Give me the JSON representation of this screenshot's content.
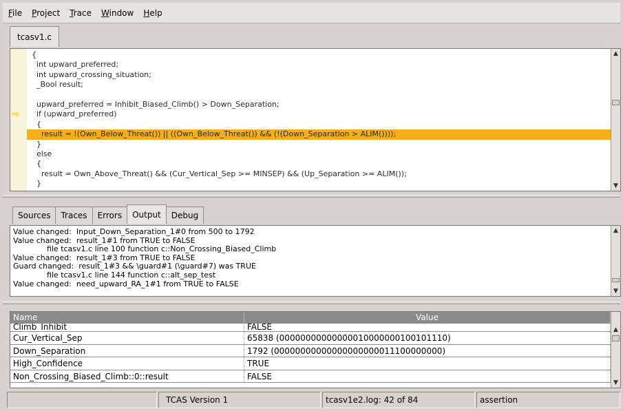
{
  "menu": [
    {
      "label": "File",
      "name": "menu-file"
    },
    {
      "label": "Project",
      "name": "menu-project"
    },
    {
      "label": "Trace",
      "name": "menu-trace"
    },
    {
      "label": "Window",
      "name": "menu-window"
    },
    {
      "label": "Help",
      "name": "menu-help"
    }
  ],
  "file_tab": "tcasv1.c",
  "editor": {
    "lines": [
      "  {",
      "    int upward_preferred;",
      "    int upward_crossing_situation;",
      "    _Bool result;",
      "",
      "    upward_preferred = Inhibit_Biased_Climb() > Down_Separation;",
      "    if (upward_preferred)",
      "    {",
      "      result = !(Own_Below_Threat()) || ((Own_Below_Threat()) && (!(Down_Separation > ALIM())));",
      "    }",
      "    else",
      "    {",
      "      result = Own_Above_Threat() && (Cur_Vertical_Sep >= MINSEP) && (Up_Separation >= ALIM());",
      "    }"
    ],
    "highlighted_line": 8,
    "arrow_line": 6,
    "arrow_color": "#e9c300",
    "highlight_color": "#f5ad18"
  },
  "panel_tabs": [
    {
      "label": "Sources",
      "name": "tab-sources",
      "active": false
    },
    {
      "label": "Traces",
      "name": "tab-traces",
      "active": false
    },
    {
      "label": "Errors",
      "name": "tab-errors",
      "active": false
    },
    {
      "label": "Output",
      "name": "tab-output",
      "active": true
    },
    {
      "label": "Debug",
      "name": "tab-debug",
      "active": false
    }
  ],
  "output_lines": [
    "Value changed:  Input_Down_Separation_1#0 from 500 to 1792",
    "Value changed:  result_1#1 from TRUE to FALSE",
    "              file tcasv1.c line 100 function c::Non_Crossing_Biased_Climb",
    "Value changed:  result_1#3 from TRUE to FALSE",
    "Guard changed:  result_1#3 && \\guard#1 (\\guard#7) was TRUE",
    "              file tcasv1.c line 144 function c::alt_sep_test",
    "Value changed:  need_upward_RA_1#1 from TRUE to FALSE"
  ],
  "table": {
    "headers": [
      "Name",
      "Value"
    ],
    "rows": [
      {
        "name": "Climb_Inhibit",
        "value": "FALSE"
      },
      {
        "name": "Cur_Vertical_Sep",
        "value": "65838 (00000000000000010000000100101110)"
      },
      {
        "name": "Down_Separation",
        "value": "1792 (00000000000000000000011100000000)"
      },
      {
        "name": "High_Confidence",
        "value": "TRUE"
      },
      {
        "name": "Non_Crossing_Biased_Climb::0::result",
        "value": "FALSE"
      }
    ]
  },
  "status": {
    "cell1": "",
    "version": "TCAS Version 1",
    "log": "tcasv1e2.log: 42 of 84",
    "mode": "assertion"
  }
}
